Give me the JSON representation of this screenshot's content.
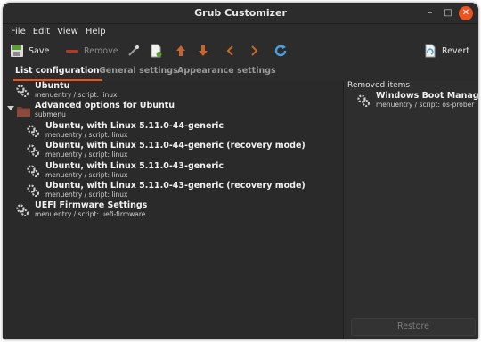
{
  "window": {
    "title": "Grub Customizer"
  },
  "menubar": [
    "File",
    "Edit",
    "View",
    "Help"
  ],
  "toolbar": {
    "save": "Save",
    "remove": "Remove",
    "revert": "Revert"
  },
  "tabs": [
    "List configuration",
    "General settings",
    "Appearance settings"
  ],
  "entries": [
    {
      "name": "Ubuntu",
      "desc": "menuentry / script: linux"
    },
    {
      "name": "Advanced options for Ubuntu",
      "desc": "submenu"
    },
    {
      "name": "Ubuntu, with Linux 5.11.0-44-generic",
      "desc": "menuentry / script: linux"
    },
    {
      "name": "Ubuntu, with Linux 5.11.0-44-generic (recovery mode)",
      "desc": "menuentry / script: linux"
    },
    {
      "name": "Ubuntu, with Linux 5.11.0-43-generic",
      "desc": "menuentry / script: linux"
    },
    {
      "name": "Ubuntu, with Linux 5.11.0-43-generic (recovery mode)",
      "desc": "menuentry / script: linux"
    },
    {
      "name": "UEFI Firmware Settings",
      "desc": "menuentry / script: uefi-firmware"
    }
  ],
  "removed": {
    "header": "Removed items",
    "items": [
      {
        "name": "Windows Boot Manager ...",
        "desc": "menuentry / script: os-prober"
      }
    ],
    "restore": "Restore"
  },
  "colors": {
    "accent": "#e95420",
    "refresh": "#4a9fe0",
    "arrows": "#c8652a",
    "green": "#5aa02c"
  }
}
